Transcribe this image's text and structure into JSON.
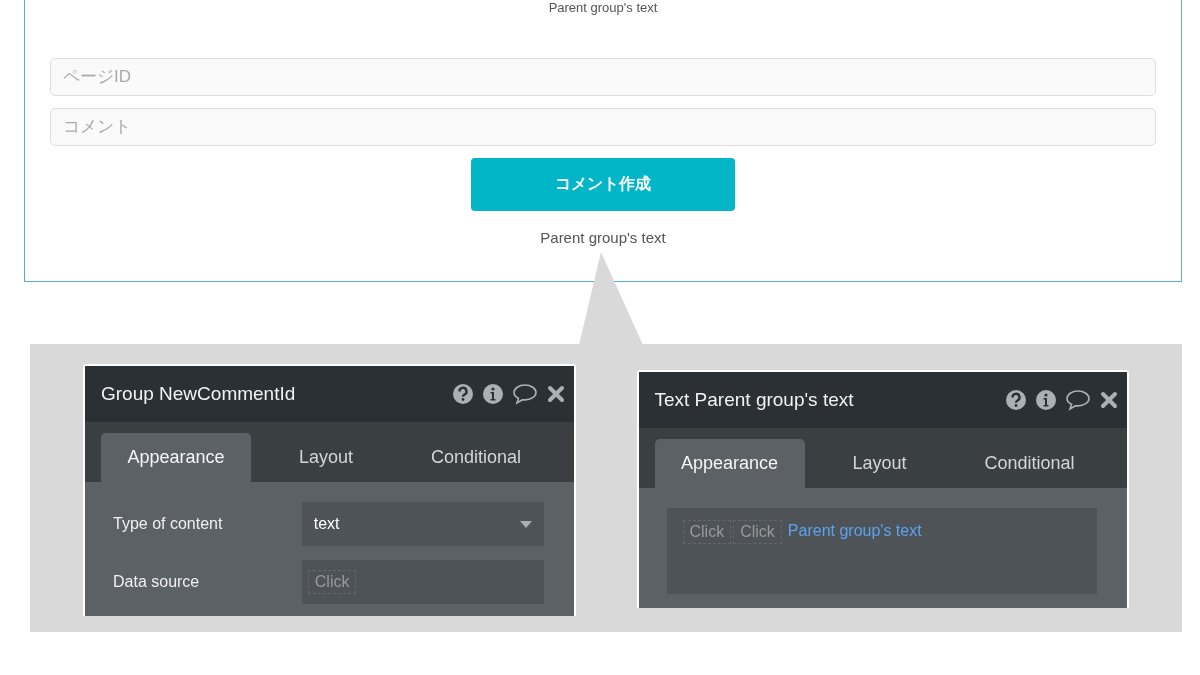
{
  "page": {
    "header_text": "Parent group's text",
    "fields": [
      {
        "placeholder": "ページID"
      },
      {
        "placeholder": "コメント"
      }
    ],
    "button": "コメント作成",
    "caption": "Parent group's text"
  },
  "editors": [
    {
      "title": "Group NewCommentId",
      "tabs": [
        {
          "label": "Appearance",
          "selected": true
        },
        {
          "label": "Layout",
          "selected": false
        },
        {
          "label": "Conditional",
          "selected": false
        }
      ],
      "rows": [
        {
          "kind": "dropdown",
          "label": "Type of content",
          "value": "text"
        },
        {
          "kind": "dynamic",
          "label": "Data source",
          "chips": [
            "Click"
          ]
        }
      ]
    },
    {
      "title": "Text Parent group's text",
      "tabs": [
        {
          "label": "Appearance",
          "selected": true
        },
        {
          "label": "Layout",
          "selected": false
        },
        {
          "label": "Conditional",
          "selected": false
        }
      ],
      "rows": [
        {
          "kind": "expression",
          "chips": [
            "Click",
            "Click"
          ],
          "value": "Parent group's text"
        }
      ]
    }
  ]
}
